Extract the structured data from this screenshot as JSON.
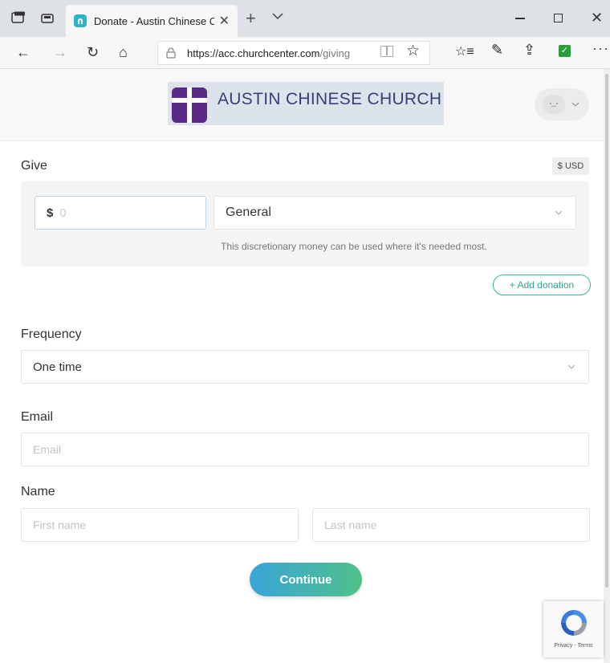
{
  "browser": {
    "tab_title": "Donate - Austin Chinese Church",
    "tab_close": "✕",
    "new_tab": "+",
    "url_host": "https://acc.churchcenter.com",
    "url_path": "/giving"
  },
  "header": {
    "org_name": "AUSTIN CHINESE CHURCH",
    "brand_color": "#5b2a86"
  },
  "give": {
    "title": "Give",
    "currency": "$ USD",
    "amount_prefix": "$",
    "amount_placeholder": "0",
    "fund_selected": "General",
    "fund_description": "This discretionary money can be used where it's needed most.",
    "add_donation": "+ Add donation"
  },
  "frequency": {
    "label": "Frequency",
    "selected": "One time"
  },
  "email": {
    "label": "Email",
    "placeholder": "Email"
  },
  "name": {
    "label": "Name",
    "first_placeholder": "First name",
    "last_placeholder": "Last name"
  },
  "continue_label": "Continue",
  "recaptcha": {
    "links": "Privacy - Terms"
  },
  "colors": {
    "accent_teal": "#3fb39b",
    "button_start": "#3aa5d8",
    "button_end": "#4fc18a"
  }
}
